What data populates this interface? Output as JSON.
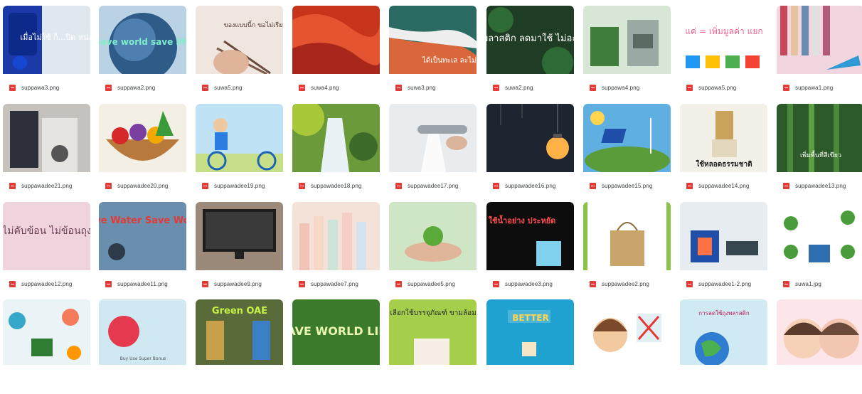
{
  "gallery": {
    "row1": [
      {
        "file": "suppawa3.png",
        "text": "เมื่อไม่ใช้ ก็...ปิด หน่อยนะ!"
      },
      {
        "file": "suppawa2.png",
        "text": "Save world save life"
      },
      {
        "file": "suwa5.png",
        "text": "ของแบบนี้ก ขอไม่เรียน"
      },
      {
        "file": "suwa4.png",
        "text": ""
      },
      {
        "file": "suwa3.png",
        "text": "ได้เป็นทะเล ละไม่ดี"
      },
      {
        "file": "suwa2.png",
        "text": "งด พลาสติก ลดมาใช้ ไม่อะไรดี"
      },
      {
        "file": "suppawa4.png",
        "text": ""
      },
      {
        "file": "suppawa5.png",
        "text": "แค่ = เพิ่มมูลค่า แยก"
      },
      {
        "file": "suppawa1.png",
        "text": ""
      }
    ],
    "row2": [
      {
        "file": "suppawadee21.png",
        "text": ""
      },
      {
        "file": "suppawadee20.png",
        "text": ""
      },
      {
        "file": "suppawadee19.png",
        "text": ""
      },
      {
        "file": "suppawadee18.png",
        "text": ""
      },
      {
        "file": "suppawadee17.png",
        "text": ""
      },
      {
        "file": "suppawadee16.png",
        "text": ""
      },
      {
        "file": "suppawadee15.png",
        "text": ""
      },
      {
        "file": "suppawadee14.png",
        "text": "ใช้หลอดธรรมชาติ"
      },
      {
        "file": "suppawadee13.png",
        "text": "เพิ่มพื้นที่สีเขียว"
      }
    ],
    "row3": [
      {
        "file": "suppawadee12.png",
        "text": "ไม่คับข้อน ไม่ข้อนถุง"
      },
      {
        "file": "suppawadee11.png",
        "text": "Save Water Save World"
      },
      {
        "file": "suppawadee9.png",
        "text": ""
      },
      {
        "file": "suppawadee7.png",
        "text": ""
      },
      {
        "file": "suppawadee5.png",
        "text": ""
      },
      {
        "file": "suppawadee3.png",
        "text": "ใช้น้ำอย่าง ประหยัด"
      },
      {
        "file": "suppawadee2.png",
        "text": ""
      },
      {
        "file": "suppawadee1-2.png",
        "text": ""
      },
      {
        "file": "suwa1.jpg",
        "text": ""
      }
    ],
    "row4": [
      {
        "text": ""
      },
      {
        "text": "Buy Use Super Bonus"
      },
      {
        "text": "Green OAE"
      },
      {
        "text": "SAVE WORLD LIFE"
      },
      {
        "text": "เลือกใช้บรรจุภัณฑ์ ขามล้อม"
      },
      {
        "text": "BETTER"
      },
      {
        "text": ""
      },
      {
        "text": "การลดใช้ถุงพลาสติก"
      },
      {
        "text": ""
      }
    ]
  },
  "colors": {
    "pdf_icon": "#e53935",
    "caption_text": "#3c4043"
  }
}
